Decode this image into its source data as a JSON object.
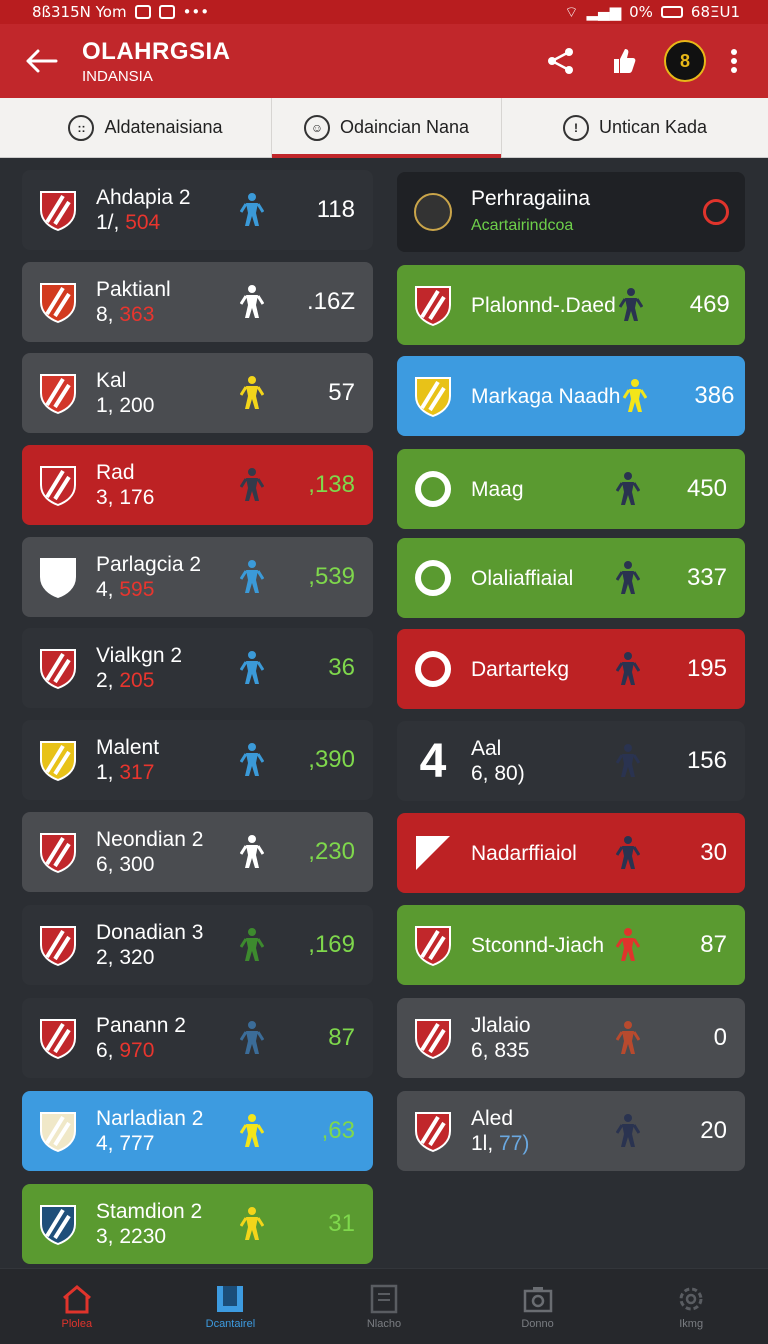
{
  "status_bar": {
    "left_text": "8ß315N Yom",
    "right_text": "0%",
    "time": "68ΞU1"
  },
  "app_bar": {
    "title": "OLAHRGSIA",
    "subtitle": "INDANSIA",
    "avatar_text": "8"
  },
  "tabs": [
    {
      "label": "Aldatenaisiana",
      "icon": "people-icon"
    },
    {
      "label": "Odaincian Nana",
      "icon": "person-icon"
    },
    {
      "label": "Untican Kada",
      "icon": "alert-icon"
    }
  ],
  "left_cards": [
    {
      "name": "Ahdapia 2",
      "sub_prefix": "1/, ",
      "sub_value": "504",
      "value": "118",
      "player": "#3b9ad8"
    },
    {
      "name": "Paktianl",
      "sub_prefix": "8, ",
      "sub_value": "363",
      "value": ".16Z",
      "player": "#ffffff"
    },
    {
      "name": "Kal",
      "sub_prefix": "1, 200",
      "sub_value": "",
      "value": "57",
      "player": "#f3d51a"
    },
    {
      "name": "Rad",
      "sub_prefix": "3, 176",
      "sub_value": "",
      "value": ",138",
      "player": "#333a4a"
    },
    {
      "name": "Parlagcia 2",
      "sub_prefix": "4, ",
      "sub_value": "595",
      "value": ",539",
      "player": "#3b9ad8"
    },
    {
      "name": "Vialkgn 2",
      "sub_prefix": "2, ",
      "sub_value": "205",
      "value": "36",
      "player": "#3b9ad8"
    },
    {
      "name": "Malent",
      "sub_prefix": "1, ",
      "sub_value": "317",
      "value": ",390",
      "player": "#3b9ad8"
    },
    {
      "name": "Neondian 2",
      "sub_prefix": "6, 300",
      "sub_value": "",
      "value": ",230",
      "player": "#ffffff"
    },
    {
      "name": "Donadian 3",
      "sub_prefix": "2, 320",
      "sub_value": "",
      "value": ",169",
      "player": "#3d8a2e"
    },
    {
      "name": "Panann 2",
      "sub_prefix": "6, ",
      "sub_value": "970",
      "value": "87",
      "player": "#3b6c98"
    },
    {
      "name": "Narladian 2",
      "sub_prefix": "4, 777",
      "sub_value": "",
      "value": ",63",
      "player": "#f3e51a"
    },
    {
      "name": "Stamdion 2",
      "sub_prefix": "3, 2230",
      "sub_value": "",
      "value": "31",
      "player": "#f3d51a"
    }
  ],
  "right_cards": [
    {
      "name": "Perhragaiina",
      "sub": "Acartairindcoa",
      "value": ""
    },
    {
      "name": "Plalonnd-.Daed",
      "sub": "",
      "value": "469"
    },
    {
      "name": "Markaga Naadh",
      "sub": "",
      "value": "386"
    },
    {
      "name": "Maag",
      "sub": "",
      "value": "450"
    },
    {
      "name": "Olaliaffiaial",
      "sub": "",
      "value": "337"
    },
    {
      "name": "Dartartekg",
      "sub": "",
      "value": "195"
    },
    {
      "name": "Aal",
      "sub": "6, 80)",
      "value": "156",
      "big": "4"
    },
    {
      "name": "Nadarffiaiol",
      "sub": "",
      "value": "30"
    },
    {
      "name": "Stconnd-Jiach",
      "sub": "",
      "value": "87"
    },
    {
      "name": "Jlalaio",
      "sub": "6, 835",
      "value": "0"
    },
    {
      "name": "Aled",
      "sub_prefix": "1l, ",
      "sub": "77)",
      "value": "20"
    }
  ],
  "bottom_nav": [
    {
      "label": "Plolea",
      "icon": "home-icon"
    },
    {
      "label": "Dcantairel",
      "icon": "bookmark-icon"
    },
    {
      "label": "Nlacho",
      "icon": "document-icon"
    },
    {
      "label": "Donno",
      "icon": "camera-icon"
    },
    {
      "label": "Ikmg",
      "icon": "settings-icon"
    }
  ],
  "colors": {
    "primary_red": "#c1272b",
    "green": "#5a9a30",
    "blue": "#3d9be0",
    "grey": "#4a4c50",
    "dark": "#2f3237"
  }
}
